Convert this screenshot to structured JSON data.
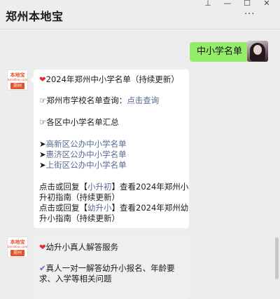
{
  "window": {
    "title": "郑州本地宝",
    "more_glyph": "···",
    "pin_glyph": "⊥",
    "minimize_glyph": "—",
    "maximize_glyph": "☐",
    "close_glyph": "✕"
  },
  "messages": {
    "self_text": "中小学名单",
    "bot_avatar": {
      "line1": "本地宝",
      "line2": "bendibao.com",
      "line3": "郑州"
    },
    "card1": {
      "heart": "❤",
      "title": "2024年郑州中小学名单（持续更新）",
      "query_prefix": "☞郑州市学校名单查询：",
      "query_link": "点击查询",
      "districts_heading": "☞各区中小学名单汇总",
      "district_links": [
        {
          "arrow": "➤",
          "label": "高新区公办中小学名单"
        },
        {
          "arrow": "➤",
          "label": "惠济区公办中小学名单"
        },
        {
          "arrow": "➤",
          "label": "上街区公办中小学名单"
        }
      ],
      "reply1_prefix": "点击或回复【",
      "reply1_keyword": "小升初",
      "reply1_suffix_a": "】查看2024年郑州小",
      "reply1_suffix_b": "升初指南（持续更新）",
      "reply2_prefix": "点击或回复【",
      "reply2_keyword": "幼升小",
      "reply2_suffix_a": "】查看2024年郑州幼",
      "reply2_suffix_b": "升小指南（持续更新）"
    },
    "card2": {
      "heart": "❤",
      "title": "幼升小真人解答服务",
      "check": "✔",
      "line_a": "真人一对一解答幼升小报名、年龄要",
      "line_b": "求、入学等相关问题"
    }
  }
}
